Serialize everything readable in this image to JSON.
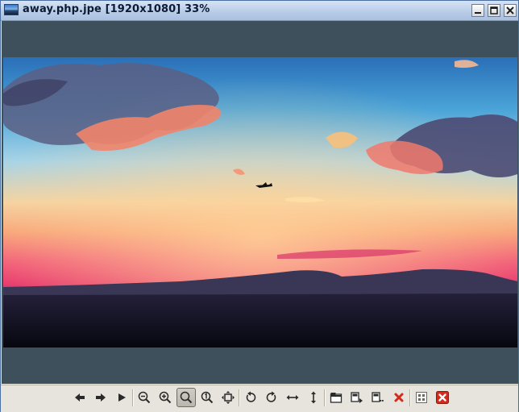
{
  "window": {
    "title": "away.php.jpe [1920x1080] 33%",
    "app_icon": "image-viewer-icon",
    "controls": [
      "minimize-icon",
      "maximize-icon",
      "close-icon"
    ]
  },
  "toolbar": {
    "buttons": [
      {
        "name": "previous-image",
        "icon": "arrow-left-icon"
      },
      {
        "name": "next-image",
        "icon": "arrow-right-icon"
      },
      {
        "name": "slideshow",
        "icon": "play-icon"
      },
      {
        "name": "zoom-out",
        "icon": "zoom-out-icon"
      },
      {
        "name": "zoom-in",
        "icon": "zoom-in-icon"
      },
      {
        "name": "zoom-fit",
        "icon": "magnifier-icon",
        "active": true
      },
      {
        "name": "zoom-100",
        "icon": "zoom-one-to-one-icon"
      },
      {
        "name": "fullscreen",
        "icon": "fit-window-icon"
      },
      {
        "name": "rotate-left",
        "icon": "rotate-ccw-icon"
      },
      {
        "name": "rotate-right",
        "icon": "rotate-cw-icon"
      },
      {
        "name": "flip-horizontal",
        "icon": "flip-horizontal-icon"
      },
      {
        "name": "flip-vertical",
        "icon": "flip-vertical-icon"
      },
      {
        "name": "open-folder",
        "icon": "folder-icon"
      },
      {
        "name": "save-as",
        "icon": "save-as-icon"
      },
      {
        "name": "properties",
        "icon": "properties-icon"
      },
      {
        "name": "delete",
        "icon": "delete-icon"
      },
      {
        "name": "preferences",
        "icon": "preferences-icon"
      },
      {
        "name": "quit",
        "icon": "quit-icon"
      }
    ]
  },
  "colors": {
    "viewer_background": "#3e505b",
    "delete": "#d42a1c",
    "quit": "#d42a1c"
  }
}
